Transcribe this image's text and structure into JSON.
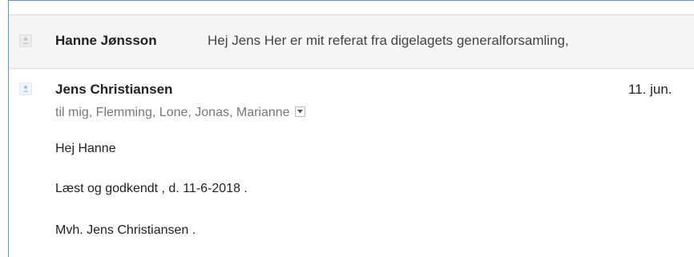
{
  "thread": {
    "collapsed_message": {
      "sender": "Hanne Jønsson",
      "snippet": "Hej Jens Her er mit referat fra digelagets generalforsamling,",
      "avatar_icon": "person-avatar-icon"
    },
    "expanded_message": {
      "sender": "Jens Christiansen",
      "date": "11. jun.",
      "recipients": "til mig, Flemming, Lone, Jonas, Marianne",
      "details_icon": "chevron-down-icon",
      "avatar_icon": "person-avatar-icon",
      "body": {
        "greeting": "Hej Hanne",
        "line": "Læst og godkendt , d. 11-6-2018 .",
        "signoff": "Mvh. Jens Christiansen ."
      }
    }
  },
  "colors": {
    "frame_border": "#6c8ebf",
    "collapsed_bg": "#f5f5f5",
    "text_primary": "#222222",
    "text_secondary": "#777777"
  }
}
